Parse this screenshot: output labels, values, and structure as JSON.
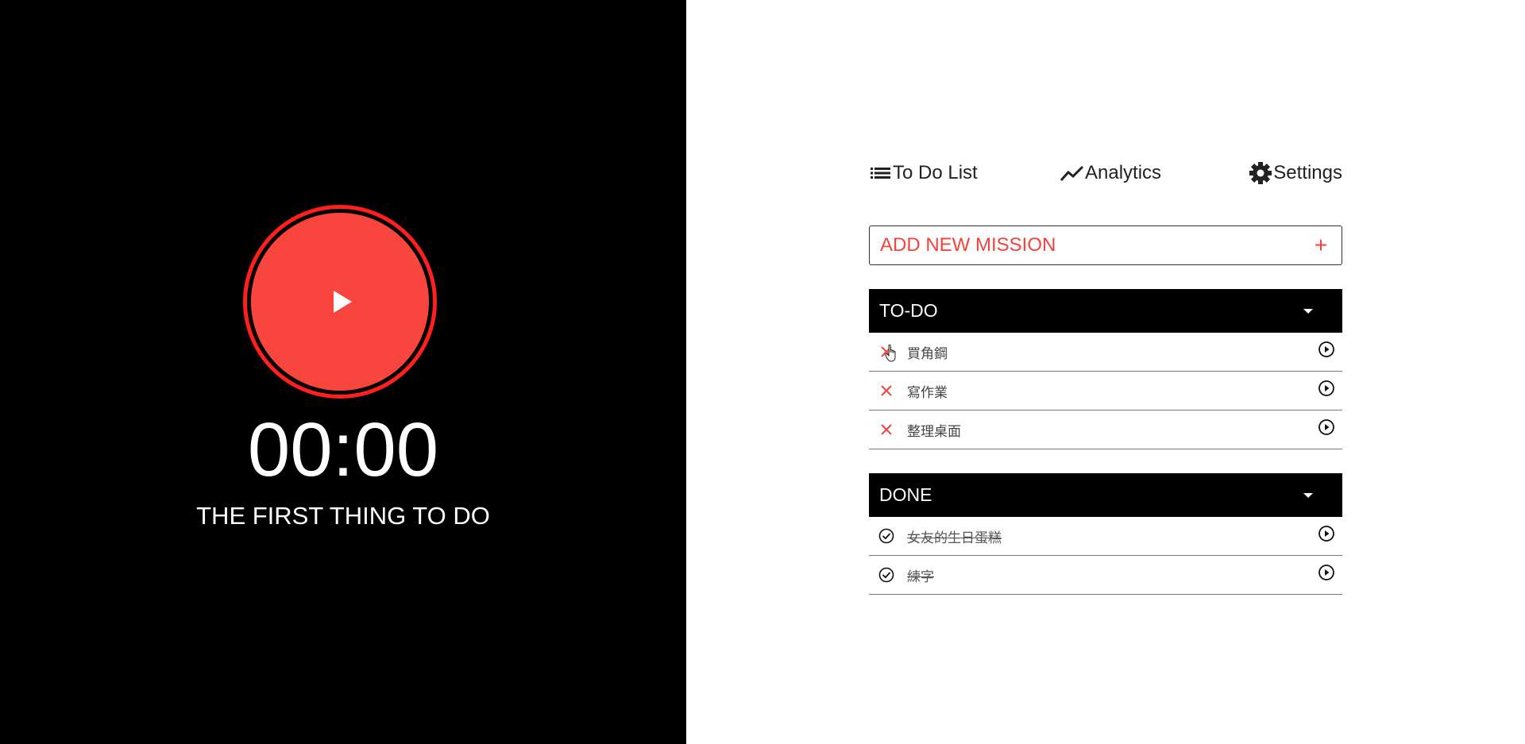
{
  "timer": {
    "time": "00:00",
    "current_task": "THE FIRST THING TO DO"
  },
  "nav": {
    "todo_label": "To Do List",
    "analytics_label": "Analytics",
    "settings_label": "Settings"
  },
  "add_mission": {
    "placeholder": "ADD NEW MISSION",
    "button_label": "+"
  },
  "todo": {
    "title": "TO-DO",
    "items": [
      {
        "text": "買角鋼"
      },
      {
        "text": "寫作業"
      },
      {
        "text": "整理桌面"
      }
    ]
  },
  "done": {
    "title": "DONE",
    "items": [
      {
        "text": "女友的生日蛋糕"
      },
      {
        "text": "練字"
      }
    ]
  },
  "colors": {
    "accent": "#f8463e",
    "ring": "#ff1f1f",
    "dark": "#000000"
  }
}
